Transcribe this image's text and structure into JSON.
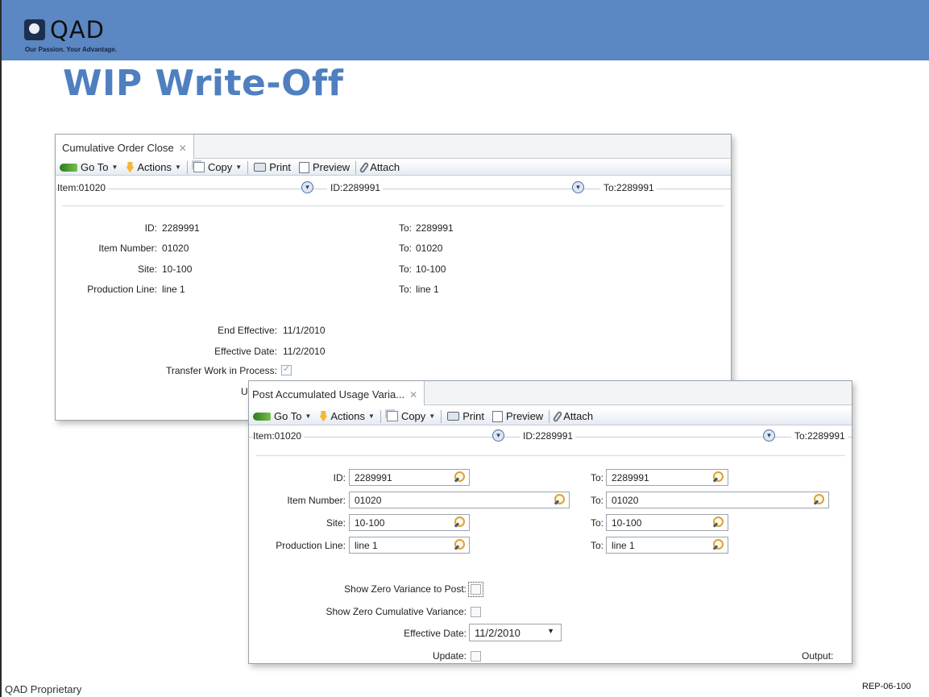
{
  "logo": {
    "name": "QAD",
    "tagline": "Our Passion. Your Advantage."
  },
  "slide": {
    "title": "WIP Write-Off",
    "footer_left": "QAD Proprietary",
    "footer_right": "REP-06-100"
  },
  "colors": {
    "band": "#5b87c2",
    "title": "#4f7fbf"
  },
  "toolbar": {
    "goto": "Go To",
    "actions": "Actions",
    "copy": "Copy",
    "print": "Print",
    "preview": "Preview",
    "attach": "Attach"
  },
  "window1": {
    "tab": "Cumulative Order Close",
    "filter": {
      "item": "Item:01020",
      "id": "ID:2289991",
      "to": "To:2289991"
    },
    "fields": {
      "id_label": "ID:",
      "id_value": "2289991",
      "id_to_label": "To:",
      "id_to_value": "2289991",
      "item_label": "Item Number:",
      "item_value": "01020",
      "item_to_label": "To:",
      "item_to_value": "01020",
      "site_label": "Site:",
      "site_value": "10-100",
      "site_to_label": "To:",
      "site_to_value": "10-100",
      "line_label": "Production Line:",
      "line_value": "line 1",
      "line_to_label": "To:",
      "line_to_value": "line 1",
      "end_eff_label": "End Effective:",
      "end_eff_value": "11/1/2010",
      "eff_date_label": "Effective Date:",
      "eff_date_value": "11/2/2010",
      "transfer_label": "Transfer Work in Process:",
      "partial_label": "U"
    },
    "transfer_checked": true
  },
  "window2": {
    "tab": "Post Accumulated Usage Varia...",
    "filter": {
      "item": "Item:01020",
      "id": "ID:2289991",
      "to": "To:2289991"
    },
    "fields": {
      "id_label": "ID:",
      "id_value": "2289991",
      "id_to_label": "To:",
      "id_to_value": "2289991",
      "item_label": "Item Number:",
      "item_value": "01020",
      "item_to_label": "To:",
      "item_to_value": "01020",
      "site_label": "Site:",
      "site_value": "10-100",
      "site_to_label": "To:",
      "site_to_value": "10-100",
      "line_label": "Production Line:",
      "line_value": "line 1",
      "line_to_label": "To:",
      "line_to_value": "line 1",
      "show_zero_var_label": "Show Zero Variance to Post:",
      "show_zero_cum_label": "Show Zero Cumulative Variance:",
      "eff_date_label": "Effective Date:",
      "eff_date_value": "11/2/2010",
      "update_label": "Update:",
      "output_label": "Output:"
    },
    "show_zero_var_checked": false,
    "show_zero_cum_checked": false,
    "update_checked": false
  }
}
